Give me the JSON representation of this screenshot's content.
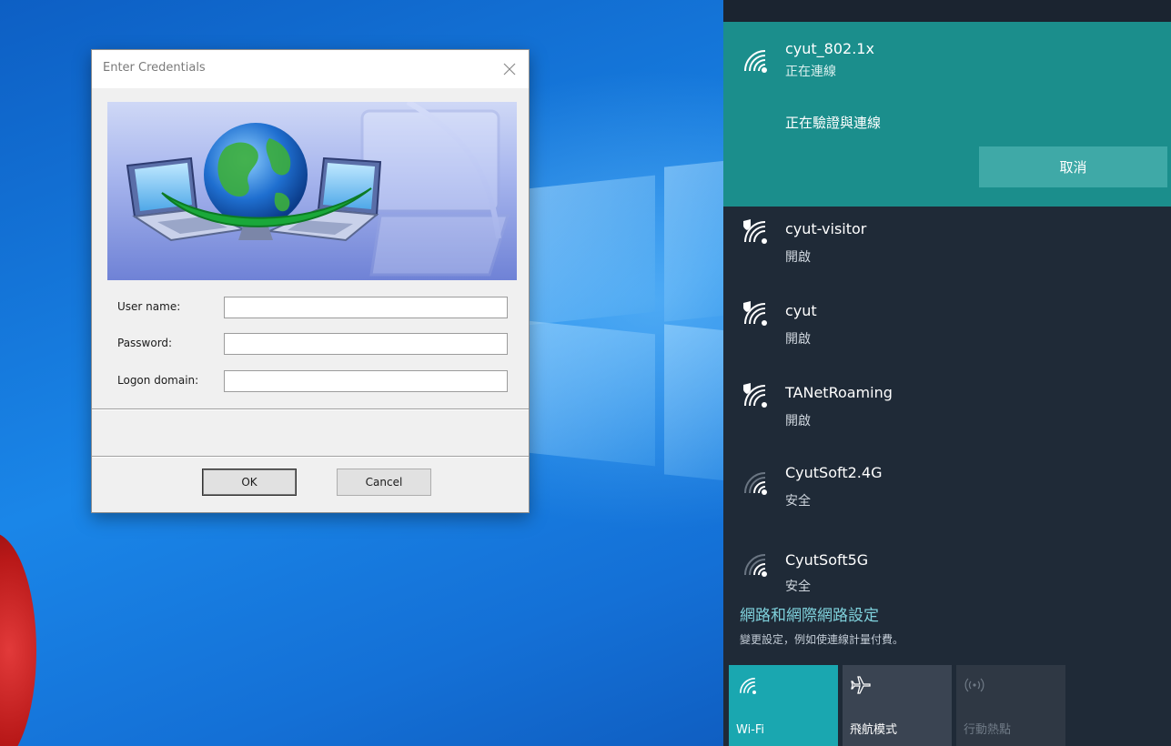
{
  "dialog": {
    "title": "Enter Credentials",
    "fields": [
      {
        "label": "User name:",
        "value": ""
      },
      {
        "label": "Password:",
        "value": ""
      },
      {
        "label": "Logon domain:",
        "value": ""
      }
    ],
    "ok_label": "OK",
    "cancel_label": "Cancel"
  },
  "network_flyout": {
    "active": {
      "name": "cyut_802.1x",
      "status": "正在連線",
      "message": "正在驗證與連線",
      "cancel_label": "取消"
    },
    "networks": [
      {
        "name": "cyut-visitor",
        "status": "開啟",
        "icon": "wifi-open-shield-icon"
      },
      {
        "name": "cyut",
        "status": "開啟",
        "icon": "wifi-open-shield-icon"
      },
      {
        "name": "TANetRoaming",
        "status": "開啟",
        "icon": "wifi-open-shield-icon"
      },
      {
        "name": "CyutSoft2.4G",
        "status": "安全",
        "icon": "wifi-weak-icon"
      },
      {
        "name": "CyutSoft5G",
        "status": "安全",
        "icon": "wifi-weak-icon"
      }
    ],
    "settings_link": "網路和網際網路設定",
    "settings_desc": "變更設定，例如使連線計量付費。",
    "quick_actions": [
      {
        "label": "Wi-Fi",
        "icon": "wifi-icon",
        "state": "on"
      },
      {
        "label": "飛航模式",
        "icon": "airplane-icon",
        "state": "off"
      },
      {
        "label": "行動熱點",
        "icon": "hotspot-icon",
        "state": "disabled"
      }
    ]
  },
  "colors": {
    "accent_teal": "#1b8e8c",
    "flyout_bg": "#1f2a37",
    "link": "#7fd1dc"
  }
}
